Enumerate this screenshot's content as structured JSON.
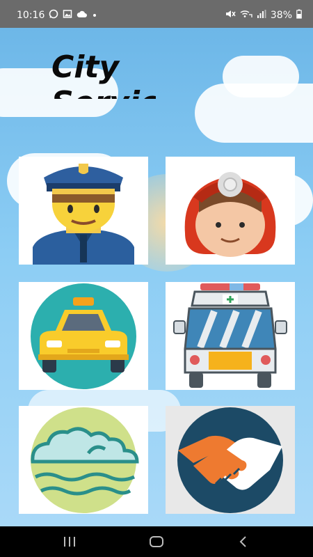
{
  "status_bar": {
    "time": "10:16",
    "battery": "38%",
    "left_icons": [
      "whatsapp-icon",
      "gallery-icon",
      "cloud-icon",
      "dot-icon"
    ],
    "right_icons": [
      "mute-icon",
      "wifi-calling-icon",
      "signal-icon",
      "battery-icon"
    ]
  },
  "app": {
    "title": "City Services",
    "services": [
      {
        "name": "police",
        "icon": "police-officer-icon"
      },
      {
        "name": "firefighter",
        "icon": "firefighter-icon"
      },
      {
        "name": "taxi",
        "icon": "taxi-icon"
      },
      {
        "name": "ambulance",
        "icon": "ambulance-icon"
      },
      {
        "name": "weather",
        "icon": "weather-icon"
      },
      {
        "name": "help",
        "icon": "handshake-icon"
      }
    ]
  },
  "nav_bar": {
    "buttons": [
      "recent-apps-icon",
      "home-icon",
      "back-icon"
    ]
  },
  "colors": {
    "sky": "#8ccdf4",
    "status_bar": "#6b6b6b",
    "nav_bar": "#000000",
    "title": "#0a0a0a"
  }
}
